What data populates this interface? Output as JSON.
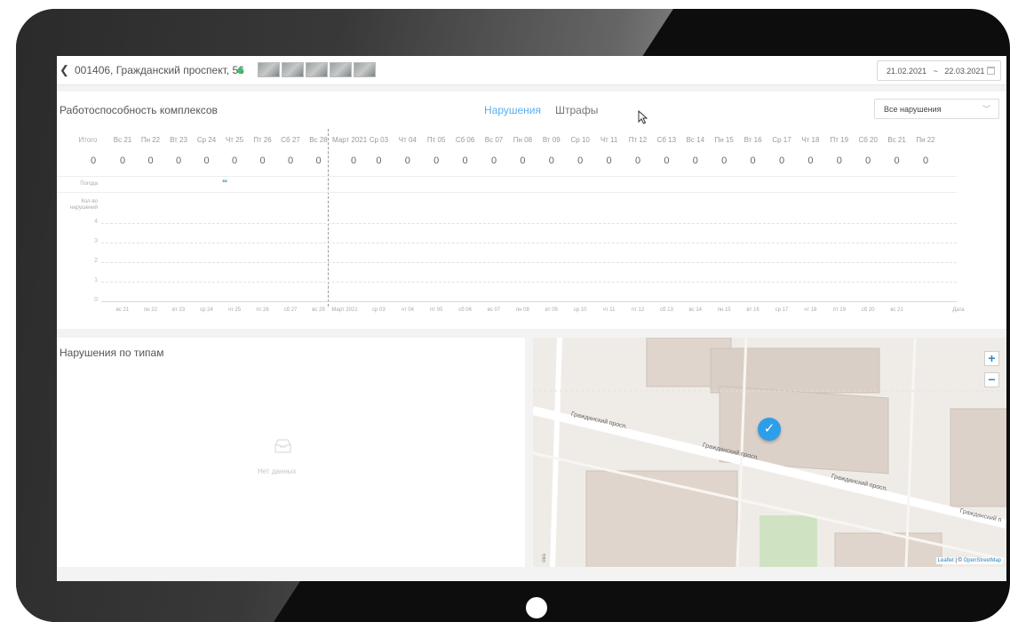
{
  "topbar": {
    "address": "001406, Гражданский проспект, 56",
    "date_from": "21.02.2021",
    "date_sep": "~",
    "date_to": "22.03.2021",
    "status_color": "#3cc06b",
    "photo_thumbnail_count": 5
  },
  "chart_panel": {
    "title": "Работоспособность комплексов",
    "tabs": [
      {
        "label": "Нарушения",
        "active": true
      },
      {
        "label": "Штрафы",
        "active": false
      }
    ],
    "filter_value": "Все нарушения",
    "total_label": "Итого",
    "total_value": "0",
    "day_headers": [
      "Вс 21",
      "Пн 22",
      "Вт 23",
      "Ср 24",
      "Чт 25",
      "Пт 26",
      "Сб 27",
      "Вс 28",
      "Март 2021",
      "Ср 03",
      "Чт 04",
      "Пт 05",
      "Сб 06",
      "Вс 07",
      "Пн 08",
      "Вт 09",
      "Ср 10",
      "Чт 11",
      "Пт 12",
      "Сб 13",
      "Вс 14",
      "Пн 15",
      "Вт 16",
      "Ср 17",
      "Чт 18",
      "Пт 19",
      "Сб 20",
      "Вс 21",
      "Пн 22"
    ],
    "day_counts": [
      "0",
      "0",
      "0",
      "0",
      "0",
      "0",
      "0",
      "0",
      "0",
      "0",
      "0",
      "0",
      "0",
      "0",
      "0",
      "0",
      "0",
      "0",
      "0",
      "0",
      "0",
      "0",
      "0",
      "0",
      "0",
      "0",
      "0",
      "0",
      "0"
    ],
    "weather_label": "Погода",
    "weather_icon": "rain-icon",
    "weather_day": "Чт 25",
    "violations_count_label": "Кол-во нарушений",
    "y_ticks": [
      "4",
      "3",
      "2",
      "1",
      "0"
    ],
    "x_ticks": [
      "вс 21",
      "пн 22",
      "вт 23",
      "ср 24",
      "чт 25",
      "пт 26",
      "сб 27",
      "вс 28",
      "Март 2021",
      "ср 03",
      "чт 04",
      "пт 05",
      "сб 06",
      "вс 07",
      "пн 08",
      "вт 09",
      "ср 10",
      "чт 11",
      "пт 12",
      "сб 13",
      "вс 14",
      "пн 15",
      "вт 16",
      "ср 17",
      "чт 18",
      "пт 19",
      "сб 20",
      "вс 21"
    ],
    "x_axis_label": "Дата"
  },
  "types_panel": {
    "title": "Нарушения по типам",
    "empty_text": "Нет данных",
    "empty_icon": "inbox-icon"
  },
  "map": {
    "street_label": "Гражданский просп.",
    "street_label_cut": "Гражданский п",
    "edge_label": "ова",
    "marker_icon": "check-marker-icon",
    "marker_color": "#2e9ee8",
    "zoom_in": "+",
    "zoom_out": "−",
    "attribution_leaflet": "Leaflet",
    "attribution_sep": " | © ",
    "attribution_osm": "OpenStreetMap"
  },
  "colors": {
    "accent": "#5aaef0",
    "weather": "#4aa5d6"
  }
}
